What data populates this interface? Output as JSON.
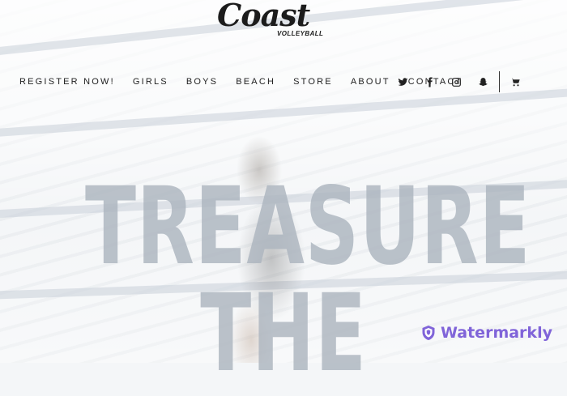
{
  "brand": {
    "name": "Coast",
    "subtitle": "VOLLEYBALL"
  },
  "nav": {
    "items": [
      {
        "label": "REGISTER NOW!"
      },
      {
        "label": "GIRLS"
      },
      {
        "label": "BOYS"
      },
      {
        "label": "BEACH"
      },
      {
        "label": "STORE"
      },
      {
        "label": "ABOUT"
      },
      {
        "label": "CONTACT"
      }
    ],
    "social_icons": [
      "twitter-icon",
      "facebook-icon",
      "instagram-icon",
      "snapchat-icon"
    ],
    "cart_icon": "cart-icon"
  },
  "hero": {
    "headline_line1": "TREASURE",
    "headline_line2": "THE"
  },
  "watermark": {
    "text": "Watermarkly",
    "color": "#8064d9"
  },
  "colors": {
    "nav_text": "#222222",
    "headline": "#acb4be"
  }
}
